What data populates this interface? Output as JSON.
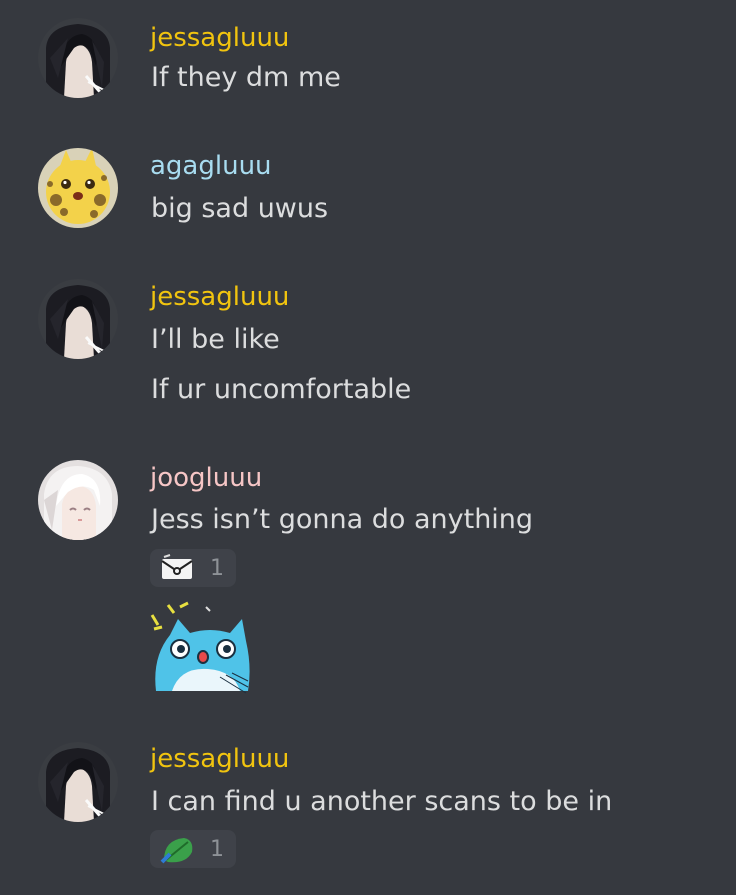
{
  "colors": {
    "background": "#36393f",
    "jessagluuu": "#f1c40f",
    "agagluuu": "#a8dcf0",
    "joogluuu": "#f6c6c6",
    "message_text": "#dcddde",
    "reaction_bg": "#3f4249",
    "reaction_count": "#8e9297"
  },
  "messages": [
    {
      "avatar_icon": "dark-haired-character-avatar",
      "username": "jessagluuu",
      "lines": [
        "If they dm me"
      ]
    },
    {
      "avatar_icon": "yellow-creature-avatar",
      "username": "agagluuu",
      "lines": [
        "big sad uwus"
      ]
    },
    {
      "avatar_icon": "dark-haired-character-avatar",
      "username": "jessagluuu",
      "lines": [
        "I’ll be like",
        "If ur uncomfortable"
      ]
    },
    {
      "avatar_icon": "white-haired-character-avatar",
      "username": "joogluuu",
      "lines": [
        "Jess isn’t gonna do anything"
      ],
      "reaction": {
        "emoji_icon": "sealed-mail-emoji",
        "count": "1"
      },
      "sticker_icon": "blue-cat-sticker"
    },
    {
      "avatar_icon": "dark-haired-character-avatar",
      "username": "jessagluuu",
      "lines": [
        "I can find u another scans to be in"
      ],
      "reaction": {
        "emoji_icon": "green-leaf-emoji",
        "count": "1"
      }
    }
  ]
}
